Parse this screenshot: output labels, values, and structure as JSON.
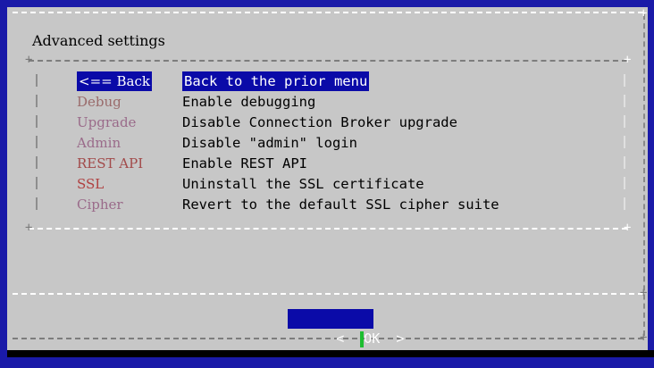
{
  "dialog": {
    "title": "Advanced settings",
    "menu": [
      {
        "tag": "<== Back",
        "desc": "Back to the prior menu",
        "tag_color": "#ffffff",
        "selected": true
      },
      {
        "tag": "Debug",
        "desc": "Enable debugging",
        "tag_color": "#9a6b6b",
        "selected": false
      },
      {
        "tag": "Upgrade",
        "desc": "Disable Connection Broker upgrade",
        "tag_color": "#9a6b8a",
        "selected": false
      },
      {
        "tag": "Admin",
        "desc": "Disable \"admin\" login",
        "tag_color": "#9a6b8a",
        "selected": false
      },
      {
        "tag": "REST API",
        "desc": "Enable REST API",
        "tag_color": "#a24a4a",
        "selected": false
      },
      {
        "tag": "SSL",
        "desc": "Uninstall the SSL certificate",
        "tag_color": "#b04040",
        "selected": false
      },
      {
        "tag": "Cipher",
        "desc": "Revert to the default SSL cipher suite",
        "tag_color": "#9a6b8a",
        "selected": false
      }
    ],
    "ok_button": {
      "left": "<",
      "label": "OK",
      "right": ">"
    }
  },
  "colors": {
    "background": "#1a1aa8",
    "dialog": "#c7c7c7",
    "highlight": "#0a0aa8"
  }
}
